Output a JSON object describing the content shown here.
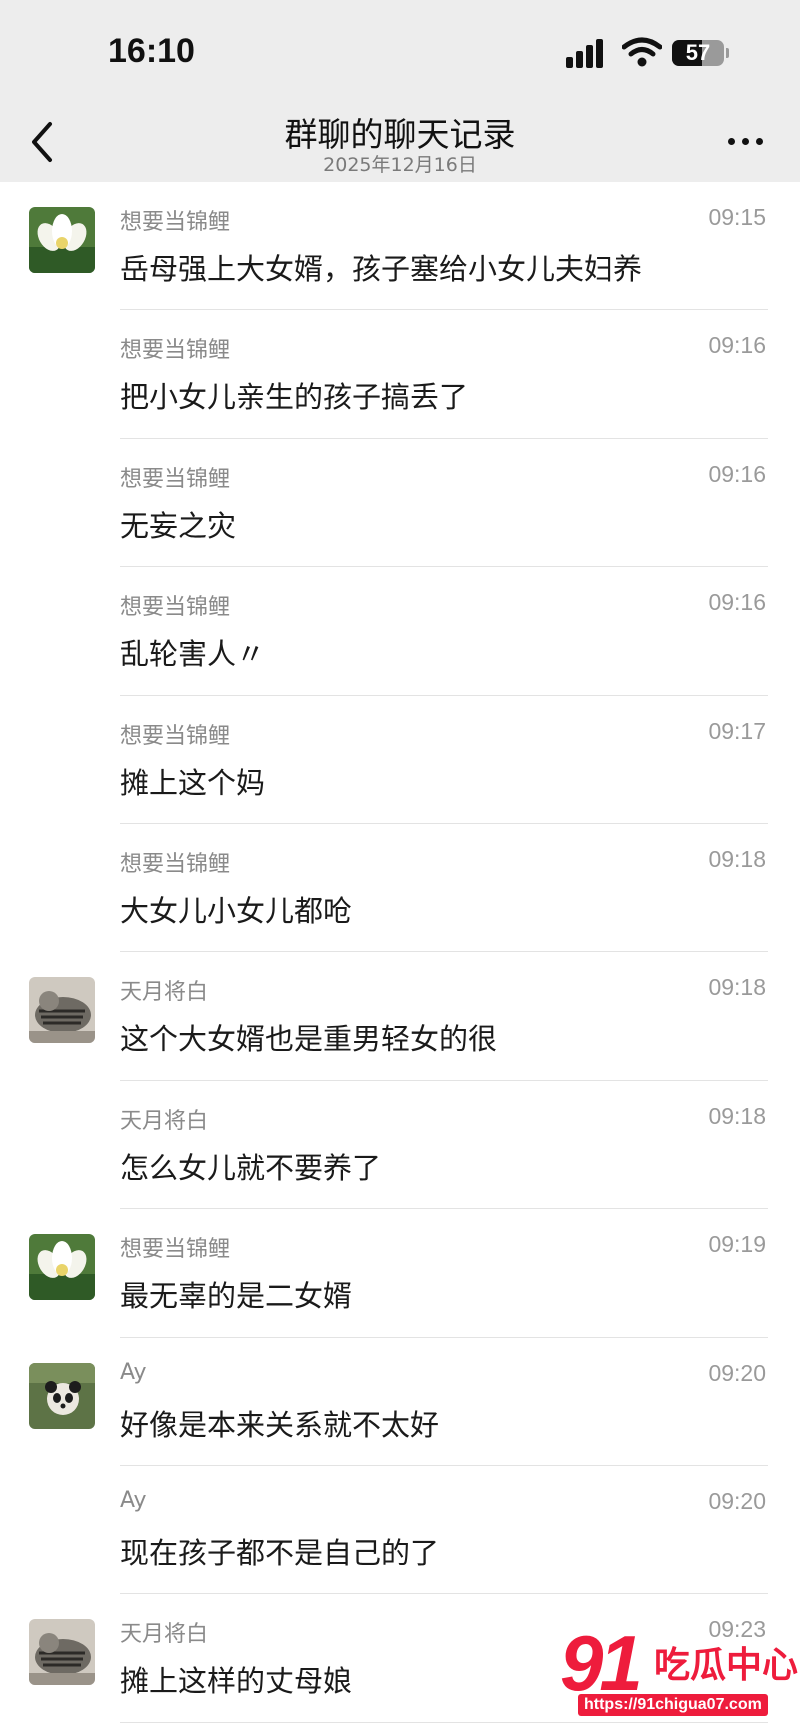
{
  "status_bar": {
    "time": "16:10",
    "battery": "57",
    "battery_level_percent": 57,
    "icons": [
      "cellular-signal-icon",
      "wifi-icon",
      "battery-icon"
    ]
  },
  "nav": {
    "title": "群聊的聊天记录",
    "subtitle": "2025年12月16日",
    "icons": [
      "back-chevron-icon",
      "more-dots-icon"
    ]
  },
  "messages": [
    {
      "sender": "想要当锦鲤",
      "time": "09:15",
      "text": "岳母强上大女婿，孩子塞给小女儿夫妇养",
      "avatar": "lotus"
    },
    {
      "sender": "想要当锦鲤",
      "time": "09:16",
      "text": "把小女儿亲生的孩子搞丢了",
      "avatar": ""
    },
    {
      "sender": "想要当锦鲤",
      "time": "09:16",
      "text": "无妄之灾",
      "avatar": ""
    },
    {
      "sender": "想要当锦鲤",
      "time": "09:16",
      "text": "乱轮害人〃",
      "avatar": ""
    },
    {
      "sender": "想要当锦鲤",
      "time": "09:17",
      "text": "摊上这个妈",
      "avatar": ""
    },
    {
      "sender": "想要当锦鲤",
      "time": "09:18",
      "text": "大女儿小女儿都呛",
      "avatar": ""
    },
    {
      "sender": "天月将白",
      "time": "09:18",
      "text": "这个大女婿也是重男轻女的很",
      "avatar": "cat"
    },
    {
      "sender": "天月将白",
      "time": "09:18",
      "text": "怎么女儿就不要养了",
      "avatar": ""
    },
    {
      "sender": "想要当锦鲤",
      "time": "09:19",
      "text": "最无辜的是二女婿",
      "avatar": "lotus"
    },
    {
      "sender": "Ay",
      "time": "09:20",
      "text": "好像是本来关系就不太好",
      "avatar": "panda"
    },
    {
      "sender": "Ay",
      "time": "09:20",
      "text": "现在孩子都不是自己的了",
      "avatar": ""
    },
    {
      "sender": "天月将白",
      "time": "09:23",
      "text": "摊上这样的丈母娘",
      "avatar": "cat"
    }
  ],
  "watermark": {
    "number": "91",
    "name": "吃瓜中心",
    "url": "https://91chigua07.com"
  },
  "colors": {
    "top_bar": "#ededed",
    "watermark_red": "#ee1c3c"
  }
}
